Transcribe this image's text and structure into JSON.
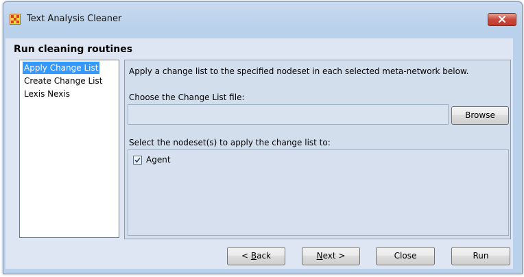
{
  "window": {
    "title": "Text Analysis Cleaner"
  },
  "heading": "Run cleaning routines",
  "routines": [
    {
      "label": "Apply Change List",
      "selected": true
    },
    {
      "label": "Create Change List",
      "selected": false
    },
    {
      "label": "Lexis Nexis",
      "selected": false
    }
  ],
  "panel": {
    "description": "Apply a change list to the specified nodeset in each selected meta-network below.",
    "file_label": "Choose the Change List file:",
    "file_value": "",
    "browse_label": "Browse",
    "nodeset_label": "Select the nodeset(s) to apply the change list to:",
    "nodesets": [
      {
        "label": "Agent",
        "checked": true
      }
    ]
  },
  "buttons": {
    "back": {
      "prefix": "< ",
      "accel": "B",
      "rest": "ack"
    },
    "next": {
      "accel": "N",
      "rest": "ext >"
    },
    "close": "Close",
    "run": "Run"
  },
  "colors": {
    "selection": "#3399ff",
    "titlebar": "#c8daf0",
    "close_button": "#c8483a"
  }
}
